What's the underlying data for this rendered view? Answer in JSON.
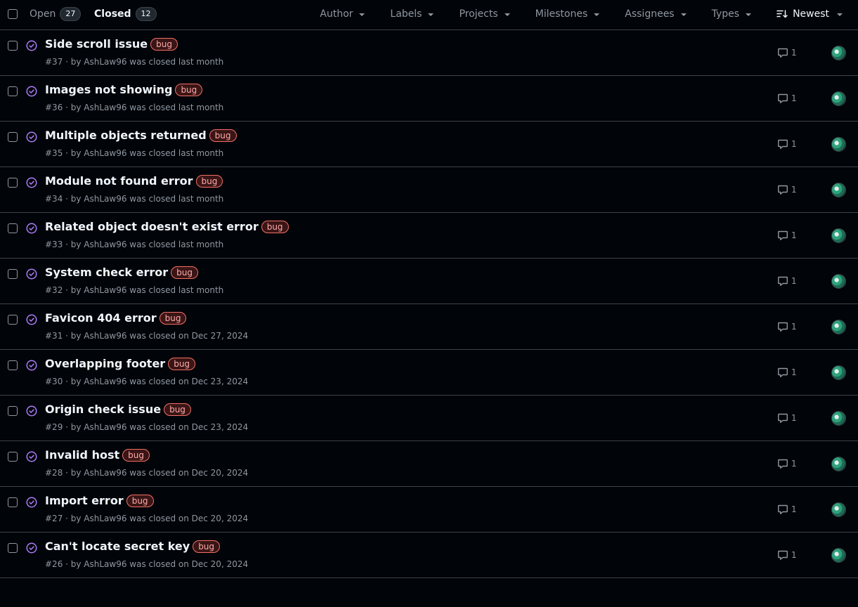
{
  "header": {
    "open_label": "Open",
    "open_count": "27",
    "closed_label": "Closed",
    "closed_count": "12",
    "filters": {
      "author": "Author",
      "labels": "Labels",
      "projects": "Projects",
      "milestones": "Milestones",
      "assignees": "Assignees",
      "types": "Types",
      "sort": "Newest"
    }
  },
  "colors": {
    "background": "#010409",
    "border": "#3d444d",
    "muted_text": "#9198a1",
    "closed_icon": "#ab7df8",
    "bug_label_border": "#f47067",
    "bug_label_text": "#ffaba8"
  },
  "icons": {
    "closed_issue": "issue-closed-icon",
    "comment": "comment-icon",
    "sort": "sort-desc-icon",
    "caret": "caret-down-icon"
  },
  "issues": [
    {
      "title": "Side scroll issue",
      "label": "bug",
      "meta": "#37 · by AshLaw96 was closed last month",
      "comments": "1"
    },
    {
      "title": "Images not showing",
      "label": "bug",
      "meta": "#36 · by AshLaw96 was closed last month",
      "comments": "1"
    },
    {
      "title": "Multiple objects returned",
      "label": "bug",
      "meta": "#35 · by AshLaw96 was closed last month",
      "comments": "1"
    },
    {
      "title": "Module not found error",
      "label": "bug",
      "meta": "#34 · by AshLaw96 was closed last month",
      "comments": "1"
    },
    {
      "title": "Related object doesn't exist error",
      "label": "bug",
      "meta": "#33 · by AshLaw96 was closed last month",
      "comments": "1"
    },
    {
      "title": "System check error",
      "label": "bug",
      "meta": "#32 · by AshLaw96 was closed last month",
      "comments": "1"
    },
    {
      "title": "Favicon 404 error",
      "label": "bug",
      "meta": "#31 · by AshLaw96 was closed on Dec 27, 2024",
      "comments": "1"
    },
    {
      "title": "Overlapping footer",
      "label": "bug",
      "meta": "#30 · by AshLaw96 was closed on Dec 23, 2024",
      "comments": "1"
    },
    {
      "title": "Origin check issue",
      "label": "bug",
      "meta": "#29 · by AshLaw96 was closed on Dec 23, 2024",
      "comments": "1"
    },
    {
      "title": "Invalid host",
      "label": "bug",
      "meta": "#28 · by AshLaw96 was closed on Dec 20, 2024",
      "comments": "1"
    },
    {
      "title": "Import error",
      "label": "bug",
      "meta": "#27 · by AshLaw96 was closed on Dec 20, 2024",
      "comments": "1"
    },
    {
      "title": "Can't locate secret key",
      "label": "bug",
      "meta": "#26 · by AshLaw96 was closed on Dec 20, 2024",
      "comments": "1"
    }
  ]
}
